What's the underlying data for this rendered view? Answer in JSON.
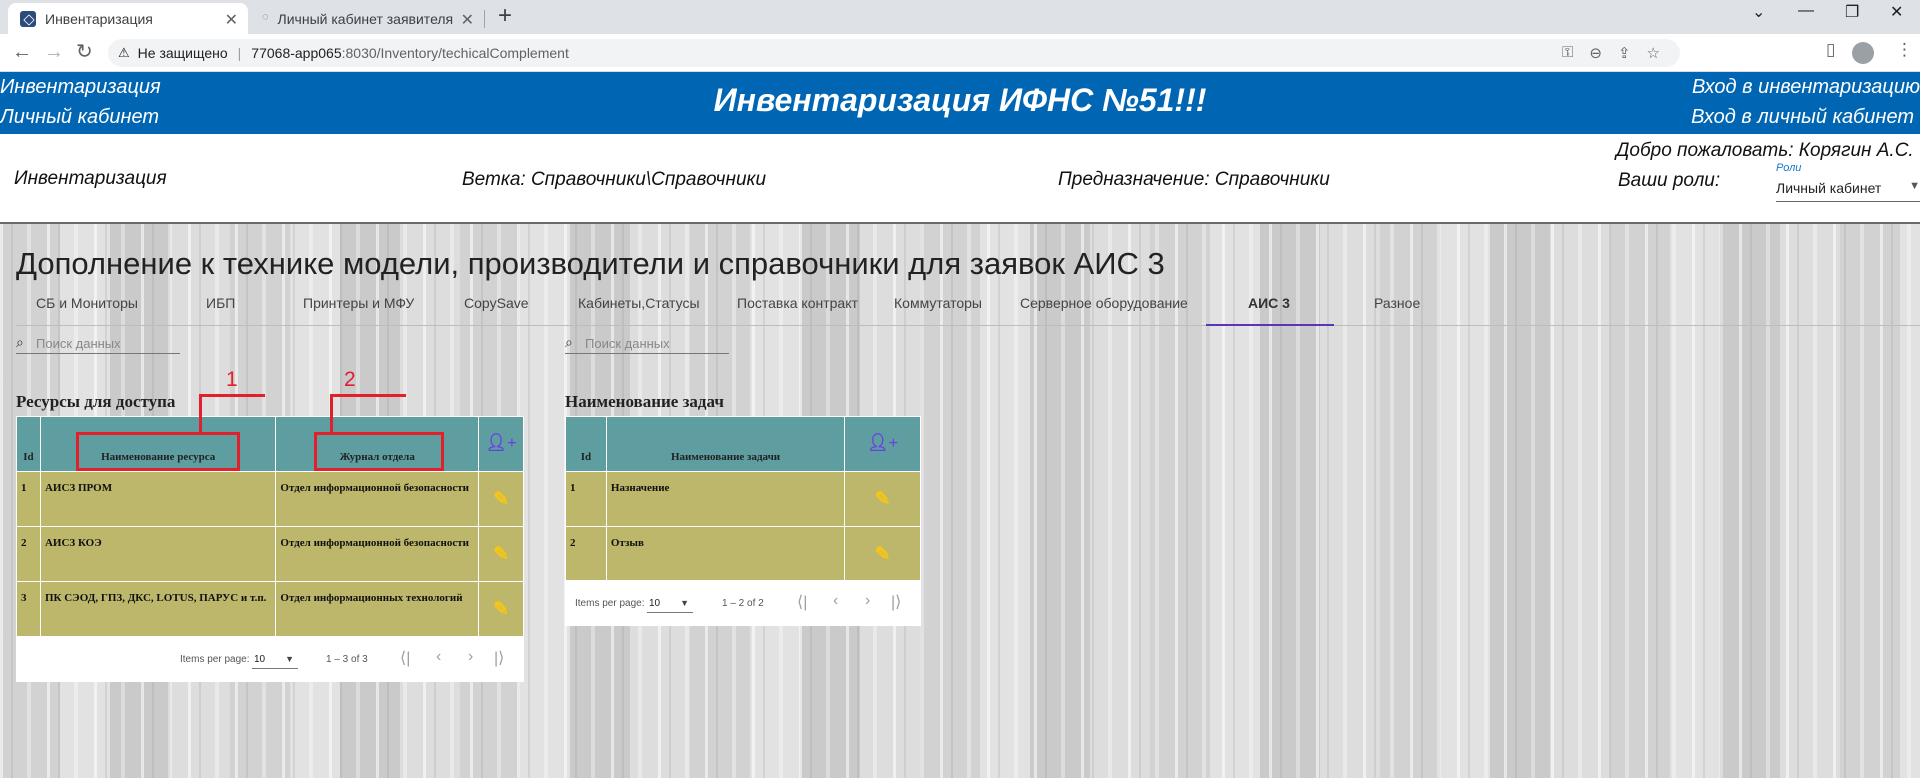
{
  "browser": {
    "tabs": [
      {
        "title": "Инвентаризация",
        "close": "✕"
      },
      {
        "title": "Личный кабинет заявителя",
        "close": "✕"
      }
    ],
    "new_tab": "+",
    "window": {
      "minimize": "⌄",
      "min": "—",
      "restore": "❐",
      "close": "✕"
    },
    "nav": {
      "back": "←",
      "forward": "→",
      "reload": "↻"
    },
    "address": {
      "warning": "⚠",
      "insecure_label": "Не защищено",
      "host": "77068-app065",
      "path": ":8030/Inventory/techicalComplement"
    },
    "omni_icons": [
      "⚿",
      "⊖",
      "⇪",
      "☆"
    ],
    "right_icons": {
      "sidepanel": "▯",
      "menu": "⋮"
    }
  },
  "header": {
    "left_links": [
      "Инвентаризация",
      "Личный кабинет"
    ],
    "title": "Инвентаризация ИФНС №51!!!",
    "right_links": [
      "Вход в инвентаризацию",
      "Вход в личный кабинет"
    ]
  },
  "subheader": {
    "module": "Инвентаризация",
    "branch": "Ветка: Справочники\\Справочники",
    "purpose": "Предназначение: Справочники",
    "welcome": "Добро пожаловать: Корягин А.С.",
    "roles_label": "Ваши роли:",
    "roles_select": {
      "label": "Роли",
      "value": "Личный кабинет"
    }
  },
  "page": {
    "title": "Дополнение к технике модели, производители и справочники для заявок АИС 3",
    "tabs": [
      "СБ и Мониторы",
      "ИБП",
      "Принтеры и МФУ",
      "CopySave",
      "Кабинеты,Статусы",
      "Поставка контракт",
      "Коммутаторы",
      "Серверное оборудование",
      "АИС 3",
      "Разное"
    ],
    "active_tab": "АИС 3",
    "search_placeholder": "Поиск данных"
  },
  "resources": {
    "title": "Ресурсы для доступа",
    "columns": [
      "Id",
      "Наименование ресурса",
      "Журнал отдела"
    ],
    "rows": [
      {
        "id": "1",
        "name": "АИСЗ ПРОМ",
        "dept": "Отдел информационной безопасности"
      },
      {
        "id": "2",
        "name": "АИСЗ КОЭ",
        "dept": "Отдел информационной безопасности"
      },
      {
        "id": "3",
        "name": "ПК СЭОД, ГПЗ, ДКС, LOTUS, ПАРУС и т.п.",
        "dept": "Отдел информационных технологий"
      }
    ],
    "paginator": {
      "items_label": "Items per page:",
      "page_size": "10",
      "range": "1 – 3 of 3"
    }
  },
  "tasks": {
    "title": "Наименование задач",
    "columns": [
      "Id",
      "Наименование задачи"
    ],
    "rows": [
      {
        "id": "1",
        "name": "Назначение"
      },
      {
        "id": "2",
        "name": "Отзыв"
      }
    ],
    "paginator": {
      "items_label": "Items per page:",
      "page_size": "10",
      "range": "1 – 2 of 2"
    }
  },
  "annotations": [
    "1",
    "2"
  ],
  "colors": {
    "header_bg": "#0066b3",
    "table_header_bg": "#5f9ea0",
    "table_row_bg": "#bdb76b",
    "edit_icon": "#f5c518",
    "add_icon": "#6a3de8",
    "active_tab_ink": "#5b34b8",
    "annotation": "#e0202a"
  },
  "icons": {
    "add_user": "person-add-icon",
    "edit": "pencil-icon",
    "search": "search-icon",
    "first_page": "⟨|",
    "prev_page": "‹",
    "next_page": "›",
    "last_page": "|⟩",
    "dropdown": "▼"
  }
}
